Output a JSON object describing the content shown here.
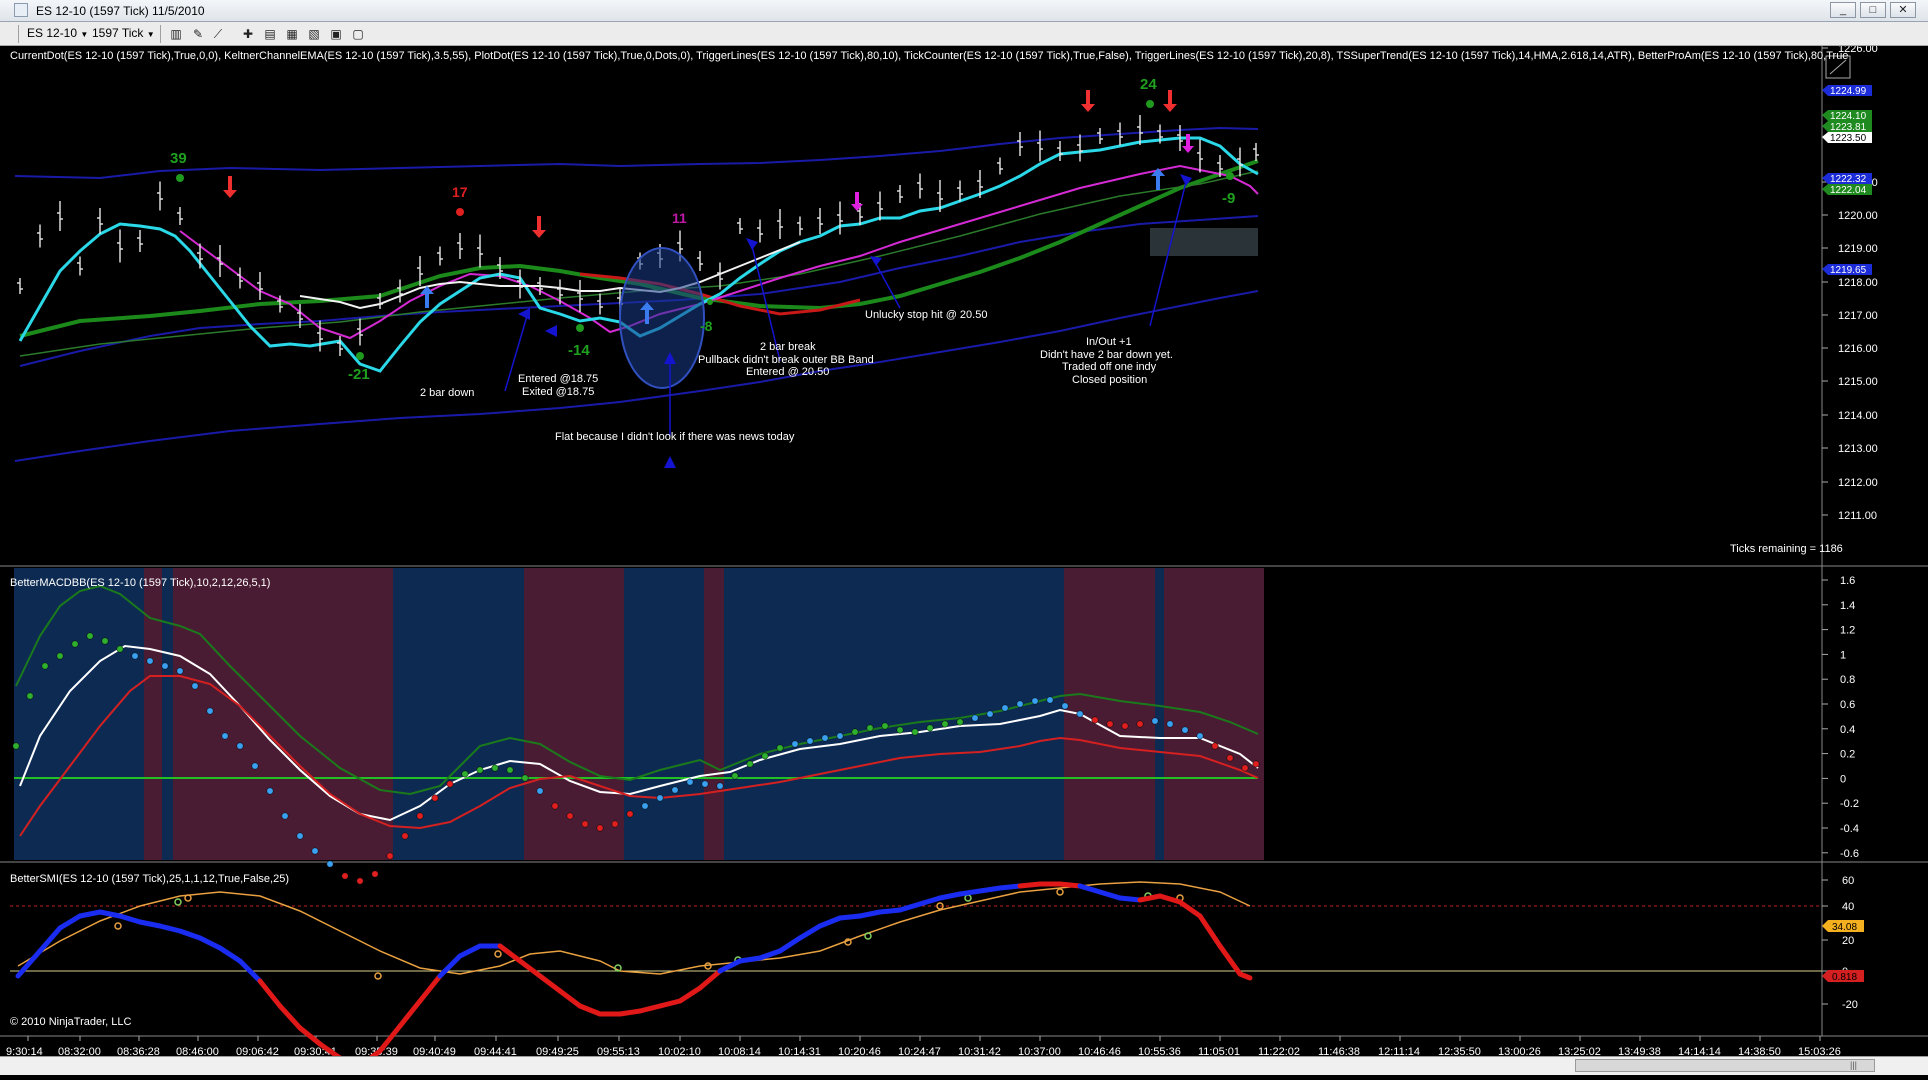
{
  "window": {
    "title": "ES 12-10 (1597 Tick)  11/5/2010",
    "buttons": [
      "_",
      "□",
      "✕",
      "—",
      "❐",
      "✕"
    ]
  },
  "toolbar": {
    "instrument": "ES 12-10",
    "interval": "1597 Tick"
  },
  "price_panel": {
    "indicator_text": "CurrentDot(ES 12-10 (1597 Tick),True,0,0), KeltnerChannelEMA(ES 12-10 (1597 Tick),3.5,55), PlotDot(ES 12-10 (1597 Tick),True,0,Dots,0), TriggerLines(ES 12-10 (1597 Tick),80,10), TickCounter(ES 12-10 (1597 Tick),True,False), TriggerLines(ES 12-10 (1597 Tick),20,8), TSSuperTrend(ES 12-10 (1597 Tick),14,HMA,2.618,14,ATR), BetterProAm(ES 12-10 (1597 Tick),80,True",
    "ticks_remaining": "Ticks remaining = 1186",
    "y_ticks": [
      "1226.00",
      "1221.00",
      "1220.00",
      "1219.00",
      "1218.00",
      "1217.00",
      "1216.00",
      "1215.00",
      "1214.00",
      "1213.00",
      "1212.00",
      "1211.00"
    ],
    "price_tags": [
      {
        "label": "1224.99",
        "color": "#1c2cd8"
      },
      {
        "label": "1224.10",
        "color": "#1f8a1f"
      },
      {
        "label": "1223.81",
        "color": "#1f8a1f"
      },
      {
        "label": "1223.50",
        "color": "#ffffff"
      },
      {
        "label": "1222.32",
        "color": "#1c2cd8"
      },
      {
        "label": "1222.04",
        "color": "#1f8a1f"
      },
      {
        "label": "1219.65",
        "color": "#1c2cd8"
      }
    ],
    "swing_labels": [
      "39",
      "17",
      "11",
      "-21",
      "-14",
      "-8",
      "24",
      "-9"
    ],
    "annotations": {
      "two_bar_down": "2 bar down",
      "entered": "Entered @18.75",
      "exited": "Exited @18.75",
      "flat": "Flat because I didn't look if there was news today",
      "two_bar_break": "2 bar break",
      "pullback": "Pullback didn't break outer BB Band",
      "entered_2050": "Entered @ 20.50",
      "stop_hit": "Unlucky stop hit @ 20.50",
      "in_out": "In/Out +1",
      "no_2bar": "Didn't have 2 bar down yet.",
      "traded_off": "Traded off one indy",
      "closed": "Closed position"
    }
  },
  "macd_panel": {
    "label": "BetterMACDBB(ES 12-10 (1597 Tick),10,2,12,26,5,1)",
    "y_ticks": [
      "1.6",
      "1.4",
      "1.2",
      "1",
      "0.8",
      "0.6",
      "0.4",
      "0.2",
      "0",
      "-0.2",
      "-0.4",
      "-0.6"
    ]
  },
  "smi_panel": {
    "label": "BetterSMI(ES 12-10 (1597 Tick),25,1,1,12,True,False,25)",
    "y_ticks": [
      "60",
      "40",
      "20",
      "0",
      "-20"
    ],
    "value_tags": [
      {
        "label": "34.08",
        "color": "#f5b020"
      },
      {
        "label": "0.818",
        "color": "#d42020"
      }
    ]
  },
  "time_axis": [
    "9:30:14",
    "08:32:00",
    "08:36:28",
    "08:46:00",
    "09:06:42",
    "09:30:41",
    "09:35:39",
    "09:40:49",
    "09:44:41",
    "09:49:25",
    "09:55:13",
    "10:02:10",
    "10:08:14",
    "10:14:31",
    "10:20:46",
    "10:24:47",
    "10:31:42",
    "10:37:00",
    "10:46:46",
    "10:55:36",
    "11:05:01",
    "11:22:02",
    "11:46:38",
    "12:11:14",
    "12:35:50",
    "13:00:26",
    "13:25:02",
    "13:49:38",
    "14:14:14",
    "14:38:50",
    "15:03:26"
  ],
  "copyright": "© 2010 NinjaTrader, LLC"
}
